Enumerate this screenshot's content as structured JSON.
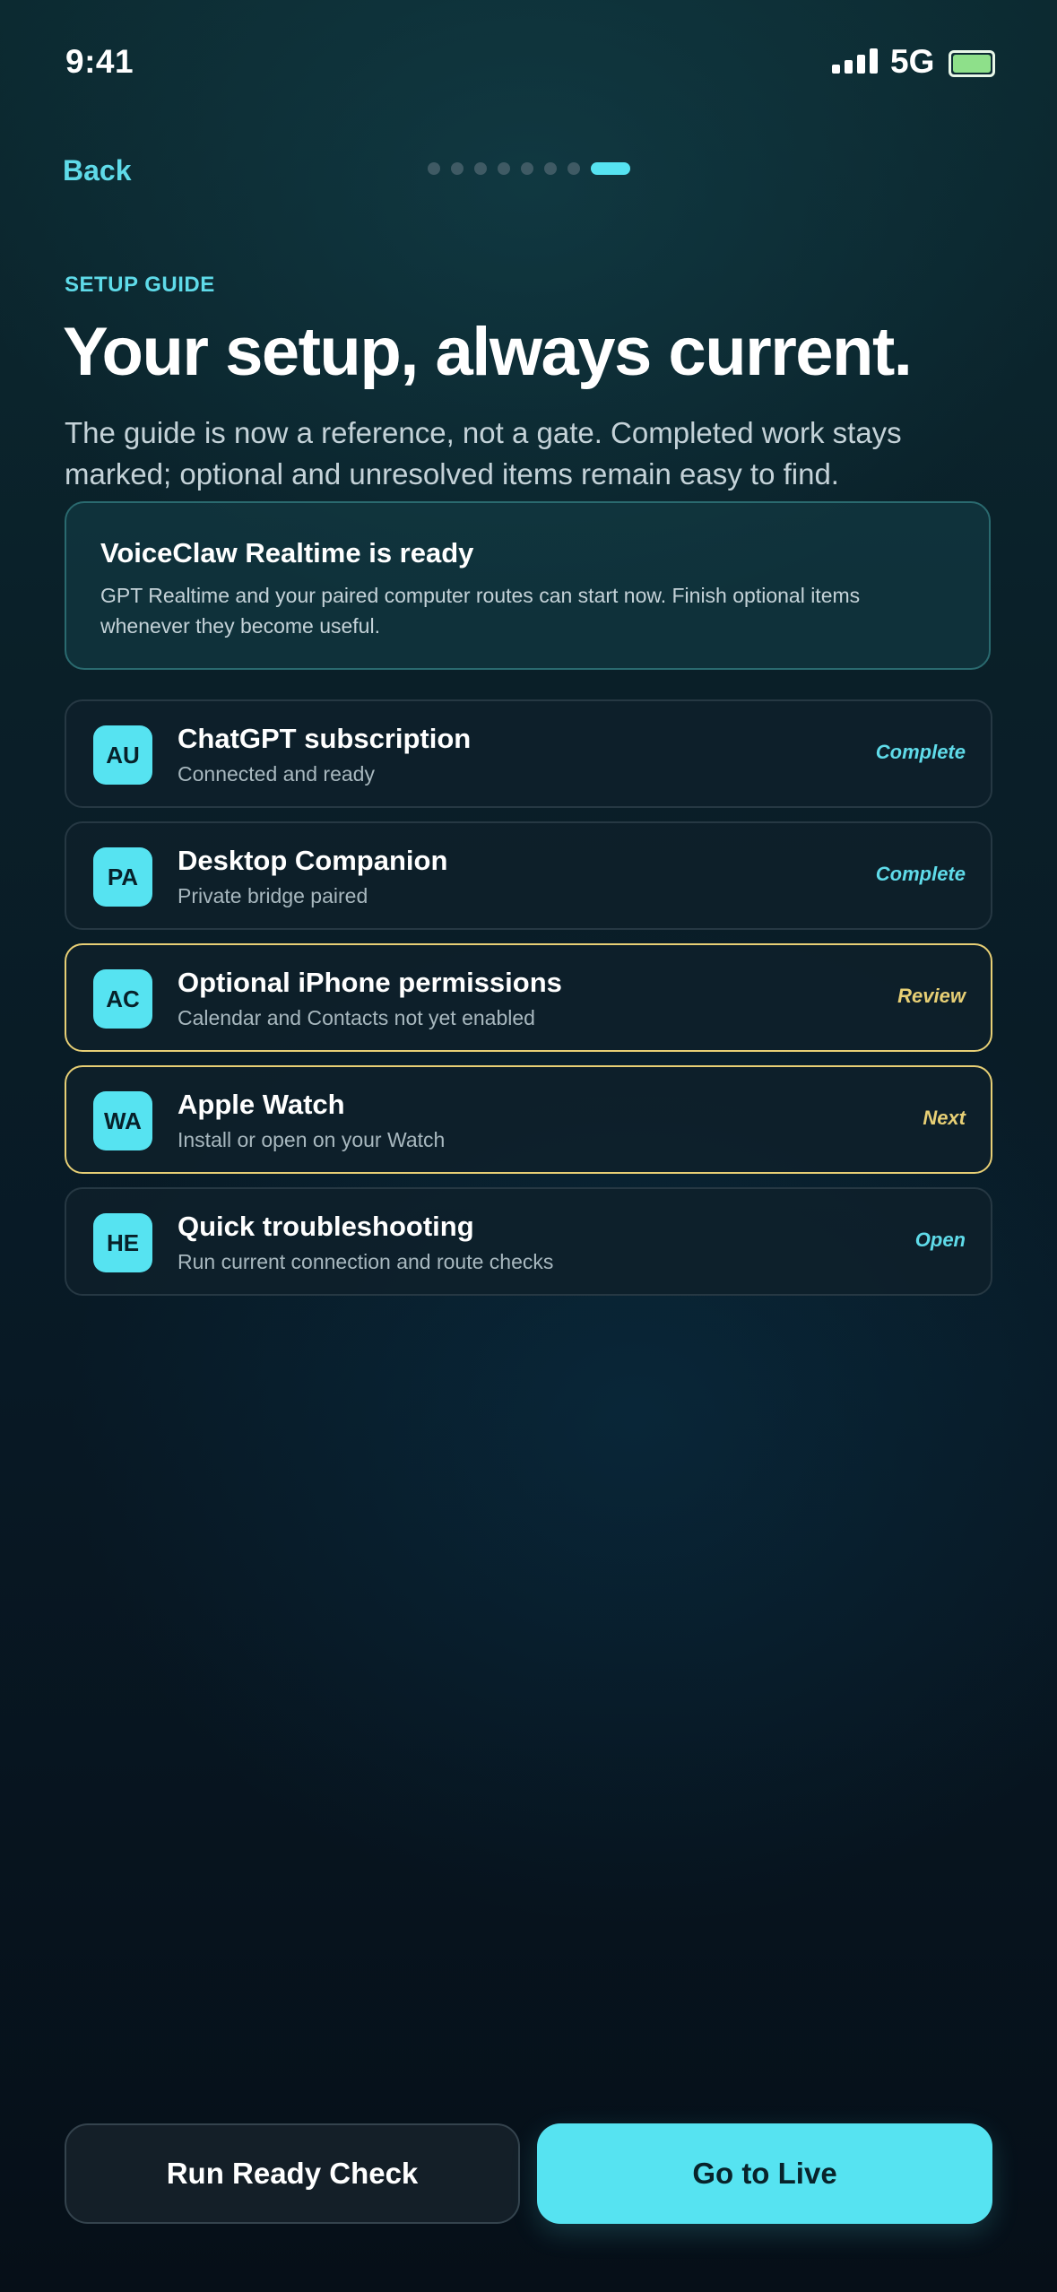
{
  "status_bar": {
    "time": "9:41",
    "network": "5G"
  },
  "nav": {
    "back_label": "Back",
    "step_count": 8,
    "active_step": 8
  },
  "header": {
    "eyebrow": "SETUP GUIDE",
    "title": "Your setup, always current.",
    "subtitle": "The guide is now a reference, not a gate. Completed work stays marked; optional and unresolved items remain easy to find."
  },
  "ready_card": {
    "title": "VoiceClaw Realtime is ready",
    "body": "GPT Realtime and your paired computer routes can start now. Finish optional items whenever they become useful."
  },
  "setup_items": [
    {
      "badge": "AU",
      "title": "ChatGPT subscription",
      "subtitle": "Connected and ready",
      "status": "Complete",
      "status_kind": "done"
    },
    {
      "badge": "PA",
      "title": "Desktop Companion",
      "subtitle": "Private bridge paired",
      "status": "Complete",
      "status_kind": "done"
    },
    {
      "badge": "AC",
      "title": "Optional iPhone permissions",
      "subtitle": "Calendar and Contacts not yet enabled",
      "status": "Review",
      "status_kind": "attention"
    },
    {
      "badge": "WA",
      "title": "Apple Watch",
      "subtitle": "Install or open on your Watch",
      "status": "Next",
      "status_kind": "attention"
    },
    {
      "badge": "HE",
      "title": "Quick troubleshooting",
      "subtitle": "Run current connection and route checks",
      "status": "Open",
      "status_kind": "done"
    }
  ],
  "actions": {
    "secondary_label": "Run Ready Check",
    "primary_label": "Go to Live"
  },
  "colors": {
    "accent": "#56e3f1",
    "attention": "#e7cf75",
    "battery": "#8ee08a",
    "background": "#081925"
  }
}
